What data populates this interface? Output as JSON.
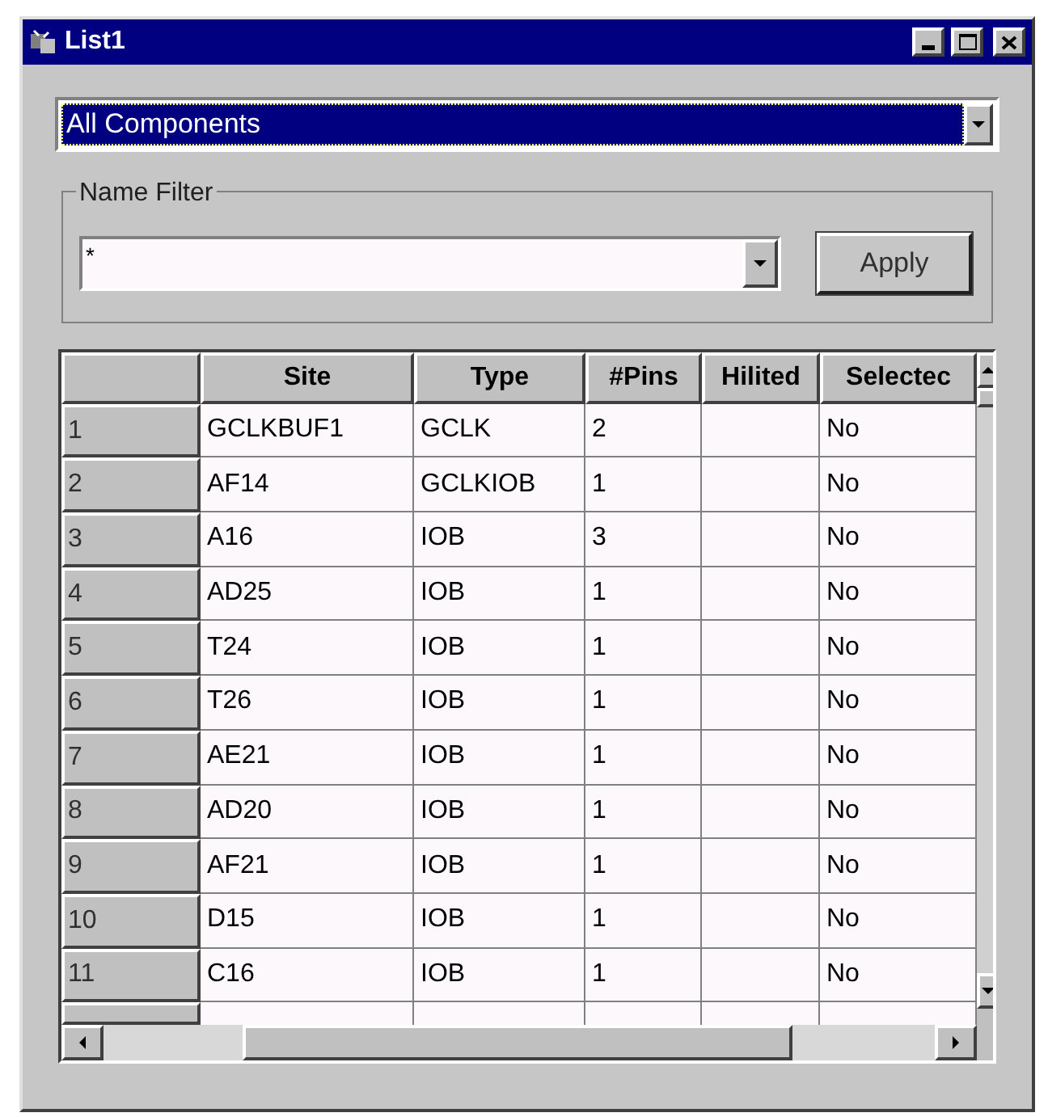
{
  "window": {
    "title": "List1"
  },
  "component_select": {
    "value": "All Components"
  },
  "name_filter": {
    "label": "Name Filter",
    "value": "*",
    "apply_button": "Apply"
  },
  "table": {
    "columns": [
      "Site",
      "Type",
      "#Pins",
      "Hilited",
      "Selectec"
    ],
    "rows": [
      {
        "number": "1",
        "cells": [
          "GCLKBUF1",
          "GCLK",
          "2",
          "",
          "No"
        ]
      },
      {
        "number": "2",
        "cells": [
          "AF14",
          "GCLKIOB",
          "1",
          "",
          "No"
        ]
      },
      {
        "number": "3",
        "cells": [
          "A16",
          "IOB",
          "3",
          "",
          "No"
        ]
      },
      {
        "number": "4",
        "cells": [
          "AD25",
          "IOB",
          "1",
          "",
          "No"
        ]
      },
      {
        "number": "5",
        "cells": [
          "T24",
          "IOB",
          "1",
          "",
          "No"
        ]
      },
      {
        "number": "6",
        "cells": [
          "T26",
          "IOB",
          "1",
          "",
          "No"
        ]
      },
      {
        "number": "7",
        "cells": [
          "AE21",
          "IOB",
          "1",
          "",
          "No"
        ]
      },
      {
        "number": "8",
        "cells": [
          "AD20",
          "IOB",
          "1",
          "",
          "No"
        ]
      },
      {
        "number": "9",
        "cells": [
          "AF21",
          "IOB",
          "1",
          "",
          "No"
        ]
      },
      {
        "number": "10",
        "cells": [
          "D15",
          "IOB",
          "1",
          "",
          "No"
        ]
      },
      {
        "number": "11",
        "cells": [
          "C16",
          "IOB",
          "1",
          "",
          "No"
        ]
      }
    ]
  }
}
